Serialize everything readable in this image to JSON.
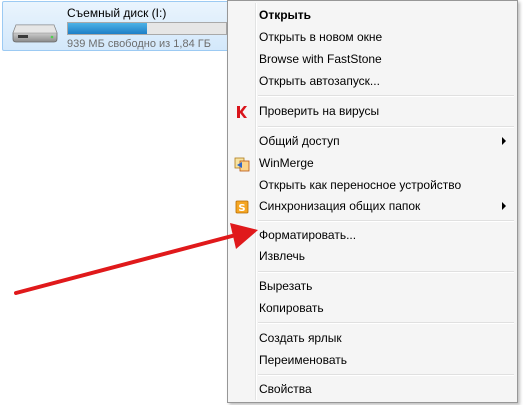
{
  "drive": {
    "name": "Съемный диск (I:)",
    "free_text": "939 МБ свободно из 1,84 ГБ",
    "used_fraction": 0.5
  },
  "menu": {
    "items": [
      {
        "label": "Открыть"
      },
      {
        "label": "Открыть в новом окне"
      },
      {
        "label": "Browse with FastStone"
      },
      {
        "label": "Открыть автозапуск..."
      },
      {
        "label": "Проверить на вирусы",
        "icon": "kaspersky-icon"
      },
      {
        "label": "Общий доступ"
      },
      {
        "label": "WinMerge",
        "icon": "winmerge-icon"
      },
      {
        "label": "Открыть как переносное устройство"
      },
      {
        "label": "Синхронизация общих папок",
        "icon": "sharepoint-sync-icon"
      },
      {
        "label": "Форматировать..."
      },
      {
        "label": "Извлечь"
      },
      {
        "label": "Вырезать"
      },
      {
        "label": "Копировать"
      },
      {
        "label": "Создать ярлык"
      },
      {
        "label": "Переименовать"
      },
      {
        "label": "Свойства"
      }
    ]
  },
  "colors": {
    "annotation_arrow": "#e0191b",
    "drive_bar": "#26a0da"
  }
}
